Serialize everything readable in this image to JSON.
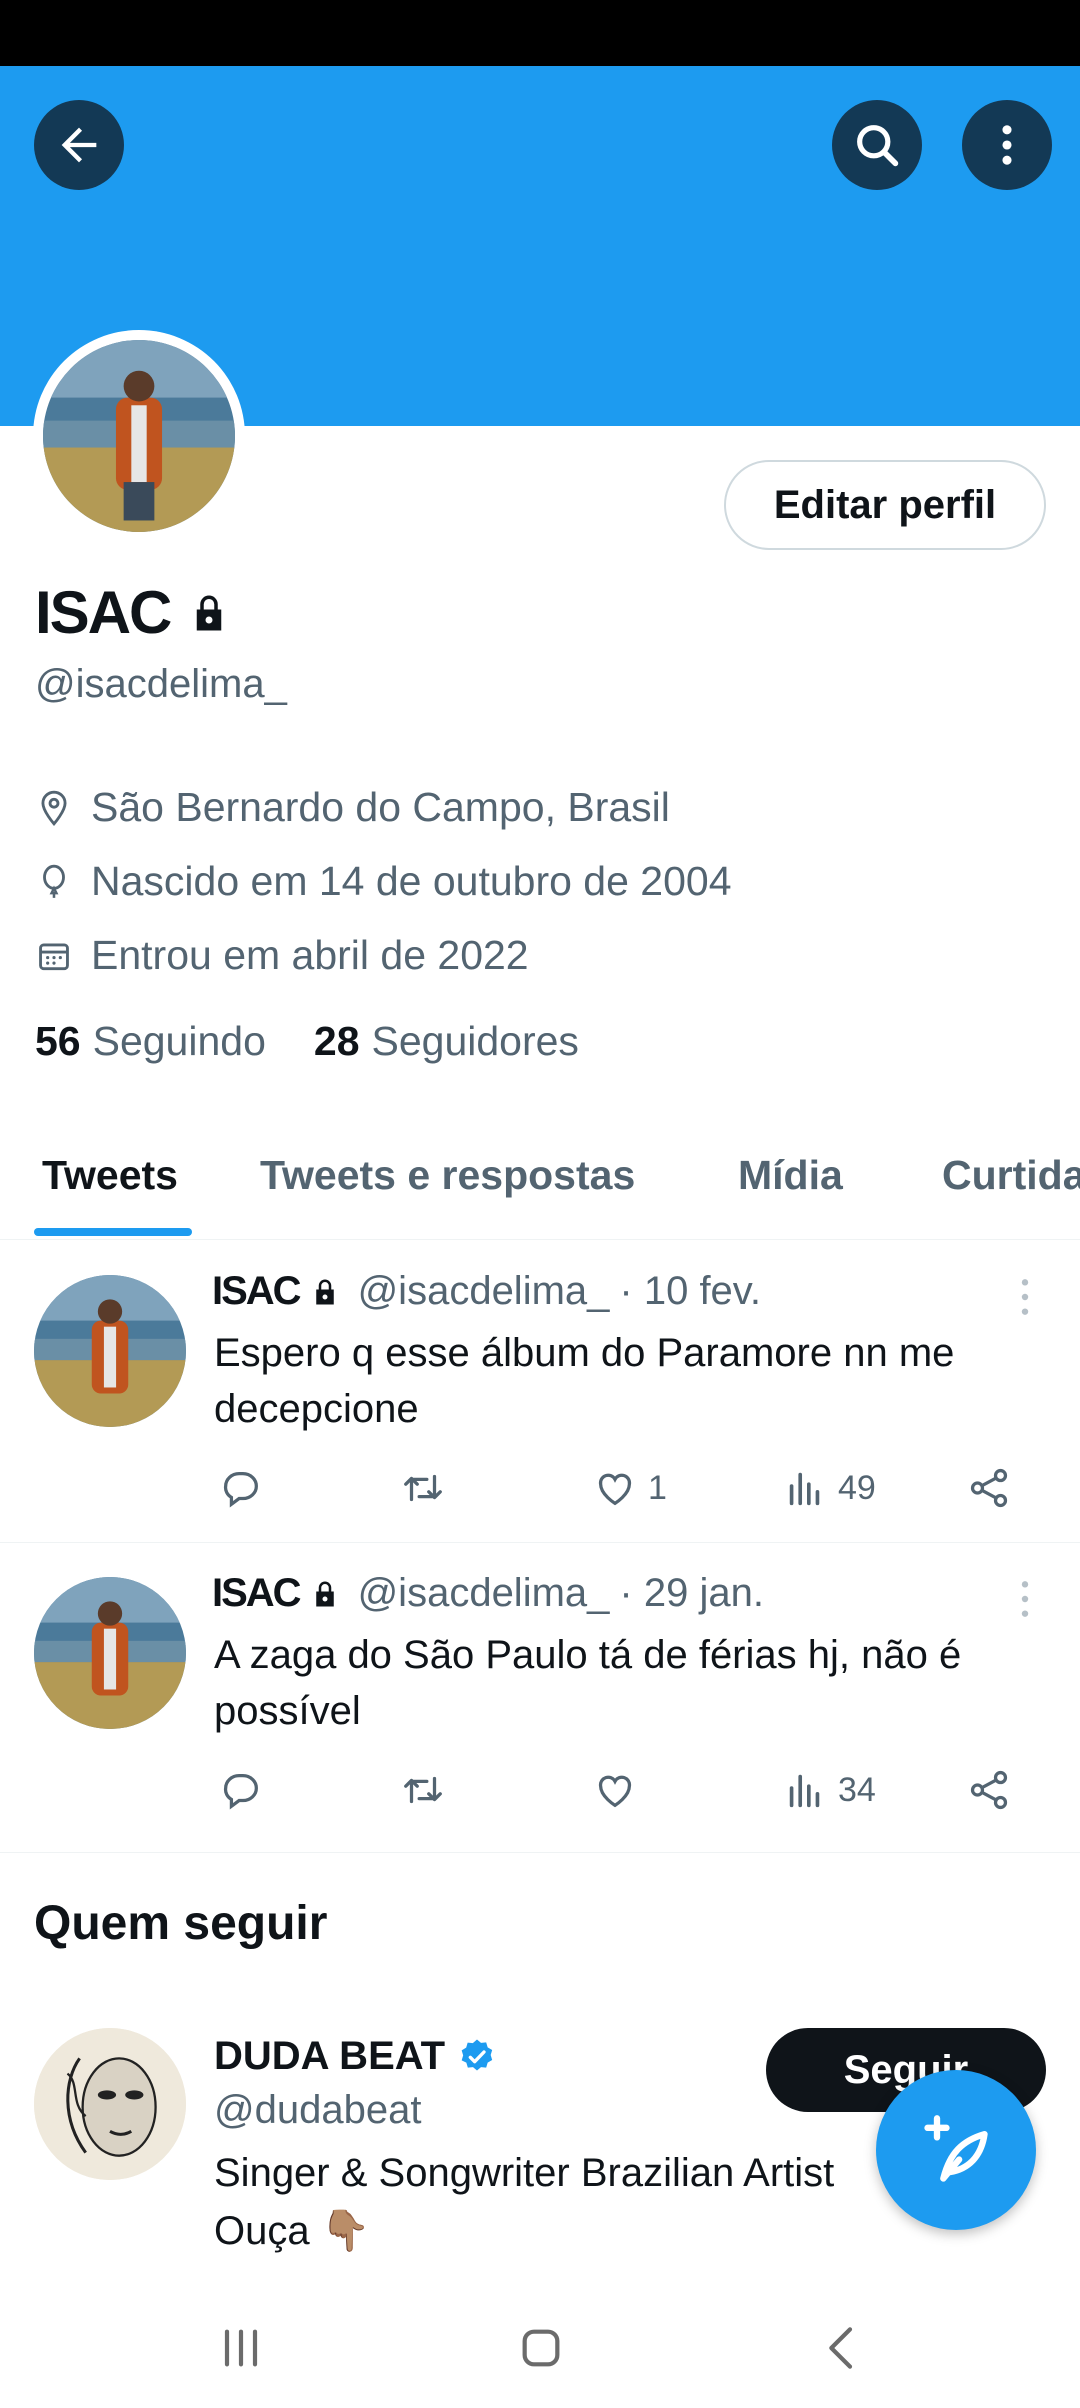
{
  "colors": {
    "accent": "#1d9bf0",
    "text": "#0f1419",
    "muted": "#536471",
    "divider": "#eff3f4"
  },
  "header": {
    "back_icon": "arrow-left-icon",
    "search_icon": "search-icon",
    "more_icon": "more-vertical-icon"
  },
  "profile": {
    "name": "ISAC",
    "handle": "@isacdelima_",
    "edit_label": "Editar perfil",
    "location": "São Bernardo do Campo, Brasil",
    "birth": "Nascido em 14 de outubro de 2004",
    "joined": "Entrou em abril de 2022",
    "following_count": "56",
    "following_label": "Seguindo",
    "followers_count": "28",
    "followers_label": "Seguidores"
  },
  "tabs": [
    {
      "label": "Tweets",
      "active": true
    },
    {
      "label": "Tweets e respostas",
      "active": false
    },
    {
      "label": "Mídia",
      "active": false
    },
    {
      "label": "Curtidas",
      "active": false
    }
  ],
  "tweets": [
    {
      "name": "ISAC",
      "handle": "@isacdelima_",
      "time": "· 10 fev.",
      "text": "Espero q esse álbum do Paramore nn me decepcione",
      "likes": "1",
      "views": "49"
    },
    {
      "name": "ISAC",
      "handle": "@isacdelima_",
      "time": "· 29 jan.",
      "text": "A zaga do São Paulo tá de férias hj, não é possível",
      "likes": "",
      "views": "34"
    }
  ],
  "who_to_follow": {
    "title": "Quem seguir",
    "name": "DUDA BEAT",
    "handle": "@dudabeat",
    "bio": "Singer & Songwriter Brazilian Artist Ouça 👇🏽",
    "follow_label": "Seguir"
  }
}
